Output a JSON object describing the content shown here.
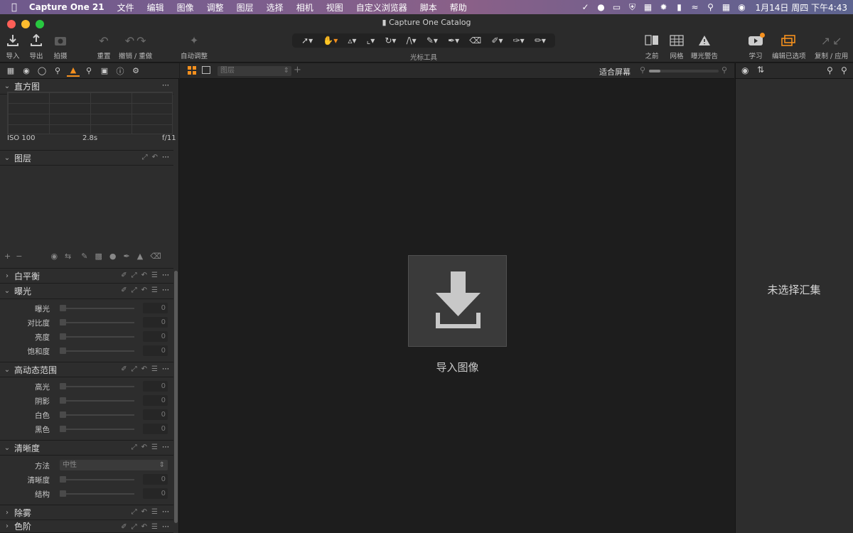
{
  "menubar": {
    "apple": "",
    "app_name": "Capture One 21",
    "items": [
      "文件",
      "编辑",
      "图像",
      "调整",
      "图层",
      "选择",
      "相机",
      "视图",
      "自定义浏览器",
      "脚本",
      "帮助"
    ],
    "clock": "1月14日 周四 下午4:43"
  },
  "window": {
    "title": "Capture One Catalog"
  },
  "toolbar": {
    "import": "导入",
    "export": "导出",
    "capture": "拍摄",
    "reset": "重置",
    "undo_redo": "撤销 / 重做",
    "auto_adjust": "自动调整",
    "cursor_tools": "光标工具",
    "before": "之前",
    "grid": "网格",
    "exposure_warning": "曝光警告",
    "learn": "学习",
    "edit_selected": "编辑已选项",
    "copy_apply": "复制 / 应用"
  },
  "histogram": {
    "title": "直方图",
    "iso": "ISO 100",
    "shutter": "2.8s",
    "aperture": "f/11"
  },
  "layers": {
    "title": "图层"
  },
  "viewer": {
    "layer_select": "图层",
    "fit": "适合屏幕",
    "import_label": "导入图像"
  },
  "white_balance": {
    "title": "白平衡"
  },
  "exposure": {
    "title": "曝光",
    "rows": [
      {
        "label": "曝光",
        "value": "0"
      },
      {
        "label": "对比度",
        "value": "0"
      },
      {
        "label": "亮度",
        "value": "0"
      },
      {
        "label": "饱和度",
        "value": "0"
      }
    ]
  },
  "hdr": {
    "title": "高动态范围",
    "rows": [
      {
        "label": "高光",
        "value": "0"
      },
      {
        "label": "阴影",
        "value": "0"
      },
      {
        "label": "白色",
        "value": "0"
      },
      {
        "label": "黑色",
        "value": "0"
      }
    ]
  },
  "clarity": {
    "title": "清晰度",
    "method_label": "方法",
    "method_value": "中性",
    "rows": [
      {
        "label": "清晰度",
        "value": "0"
      },
      {
        "label": "结构",
        "value": "0"
      }
    ]
  },
  "dehaze": {
    "title": "除雾"
  },
  "levels": {
    "title": "色阶"
  },
  "right_panel": {
    "empty_text": "未选择汇集"
  },
  "colors": {
    "accent": "#f5901e",
    "window_bg": "#2b2b2b",
    "viewer_bg": "#1d1d1d"
  }
}
